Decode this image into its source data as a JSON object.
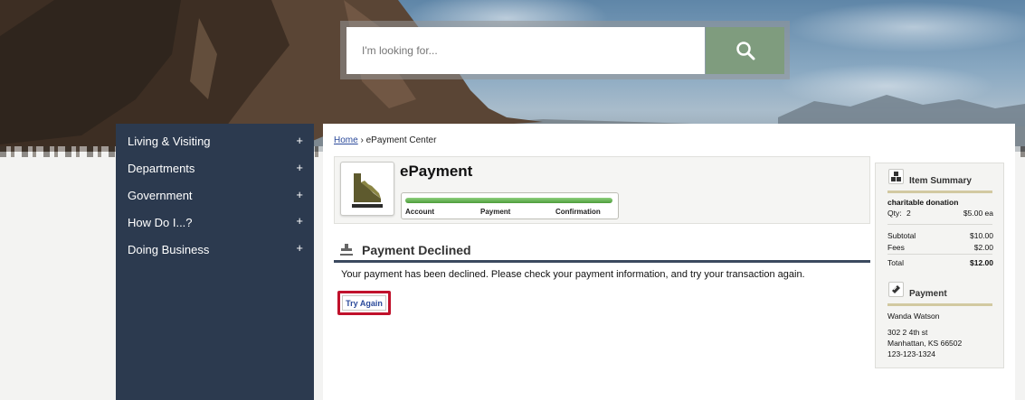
{
  "search": {
    "placeholder": "I'm looking for..."
  },
  "sidebar": {
    "items": [
      {
        "label": "Living & Visiting",
        "toggle": "+"
      },
      {
        "label": "Departments",
        "toggle": "+"
      },
      {
        "label": "Government",
        "toggle": "+"
      },
      {
        "label": "How Do I...?",
        "toggle": "+"
      },
      {
        "label": "Doing Business",
        "toggle": "+"
      }
    ]
  },
  "breadcrumb": {
    "home": "Home",
    "separator": "›",
    "current": "ePayment Center"
  },
  "epayment": {
    "title": "ePayment",
    "steps": [
      "Account",
      "Payment",
      "Confirmation"
    ]
  },
  "declined": {
    "title": "Payment Declined",
    "message": "Your payment has been declined. Please check your payment information, and try your transaction again.",
    "button": "Try Again"
  },
  "item_summary": {
    "title": "Item Summary",
    "item_name": "charitable donation",
    "qty_label": "Qty:",
    "qty_value": "2",
    "price": "$5.00 ea",
    "subtotal_label": "Subtotal",
    "subtotal_value": "$10.00",
    "fees_label": "Fees",
    "fees_value": "$2.00",
    "total_label": "Total",
    "total_value": "$12.00"
  },
  "payment": {
    "title": "Payment",
    "name": "Wanda Watson",
    "address1": "302 2 4th st",
    "address2": "Manhattan, KS 66502",
    "phone": "123-123-1324"
  },
  "colors": {
    "sidebar": "#2c3a4f",
    "search_button": "#7f9c7e",
    "progress": "#4c9c3a",
    "highlight": "#c0112b"
  }
}
